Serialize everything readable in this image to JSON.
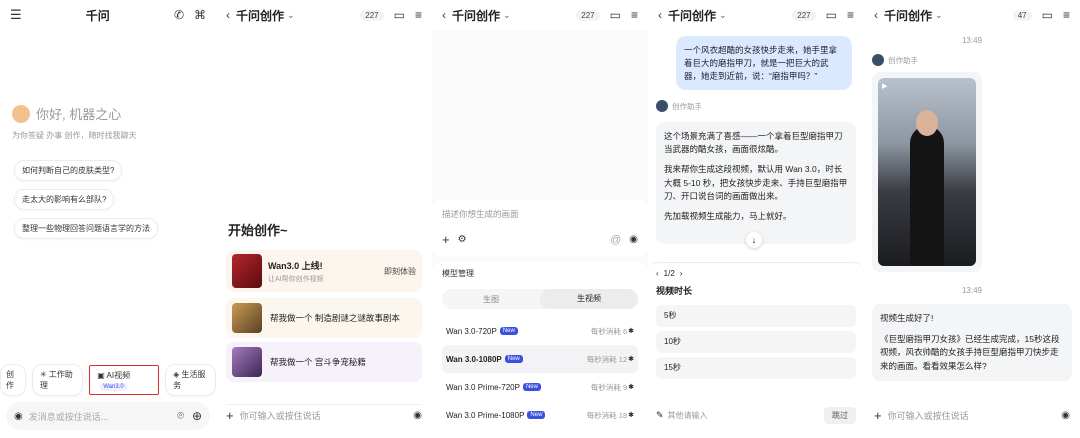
{
  "colors": {
    "accent": "#3b4fe0",
    "highlight_border": "#d9302c",
    "user_bubble": "#dbe9ff"
  },
  "p1": {
    "app_title": "千问",
    "greeting": "你好, 机器之心",
    "subtitle": "为你答疑 办事 创作，随时找我聊天",
    "suggestions": [
      "如何判断自己的皮肤类型?",
      "走太大的影响有么部队?",
      "整理一些物理回答问题语言学的方法"
    ],
    "tools": [
      {
        "label": "创作"
      },
      {
        "label": "工作助理"
      },
      {
        "label": "AI视频",
        "badge": "Wan3.0"
      },
      {
        "label": "生活服务"
      }
    ],
    "input_placeholder": "发消息或按住说话..."
  },
  "p2": {
    "title": "千问创作",
    "count": "227",
    "heading": "开始创作~",
    "cards": [
      {
        "title": "Wan3.0 上线!",
        "sub": "让AI帮你创作视频",
        "action": "即刻体验"
      },
      {
        "title": "帮我做一个 制造剧谜之谜故事剧本"
      },
      {
        "title": "帮我做一个 宫斗争宠秘籍"
      }
    ],
    "input_placeholder": "你可输入或按住说话"
  },
  "p3": {
    "title": "千问创作",
    "count": "227",
    "input_placeholder": "描述你想生成的画面",
    "section_label": "模型管理",
    "tabs": [
      "生图",
      "生视频"
    ],
    "models": [
      {
        "name": "Wan 3.0-720P",
        "tag": "New",
        "cost": "每秒消耗 6"
      },
      {
        "name": "Wan 3.0-1080P",
        "tag": "New",
        "cost": "每秒消耗 12"
      },
      {
        "name": "Wan 3.0 Prime-720P",
        "tag": "New",
        "cost": "每秒消耗 9"
      },
      {
        "name": "Wan 3.0 Prime-1080P",
        "tag": "New",
        "cost": "每秒消耗 18"
      }
    ]
  },
  "p4": {
    "title": "千问创作",
    "count": "227",
    "user_msg": "一个风衣超酷的女孩快步走来，她手里拿着巨大的磨指甲刀，就是一把巨大的武器，她走到近前，说：“磨指甲吗？”",
    "ai_name": "创作助手",
    "ai_para1": "这个场景充满了喜感——一个拿着巨型磨指甲刀当武器的酷女孩，画面很炫酷。",
    "ai_para2": "我来帮你生成这段视频，默认用 Wan 3.0，时长大概 5-10 秒，把女孩快步走来、手持巨型磨指甲刀、开口说台词的画面做出来。",
    "ai_para3": "先加载视频生成能力，马上就好。",
    "pager": "1/2",
    "form_title": "视频时长",
    "durations": [
      "5秒",
      "10秒",
      "15秒"
    ],
    "custom_placeholder": "其他请输入",
    "skip": "跳过"
  },
  "p5": {
    "title": "千问创作",
    "count": "47",
    "time1": "13:49",
    "time2": "13:49",
    "ai_name": "创作助手",
    "done_title": "视频生成好了!",
    "done_text": "《巨型磨指甲刀女孩》已经生成完成，15秒这段视频，风衣帅酷的女孩手持巨型磨指甲刀快步走来的画面。看看效果怎么样?",
    "input_placeholder": "你可输入或按住说话"
  }
}
